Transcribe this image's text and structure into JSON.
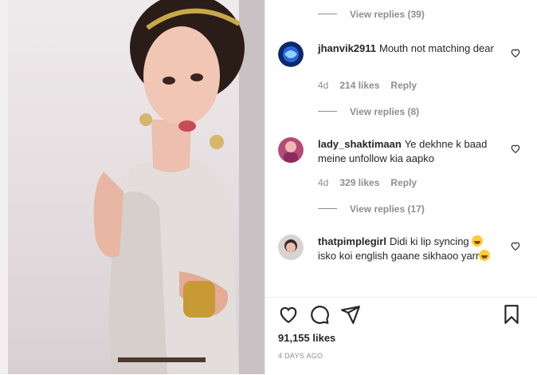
{
  "comments": [
    {
      "type": "view_replies",
      "text": "View replies (39)"
    },
    {
      "type": "comment",
      "username": "jhanvik2911",
      "text": "Mouth not matching dear",
      "time": "4d",
      "likes": "214 likes",
      "reply": "Reply"
    },
    {
      "type": "view_replies",
      "text": "View replies (8)"
    },
    {
      "type": "comment",
      "username": "lady_shaktimaan",
      "text": "Ye dekhne k baad meine unfollow kia aapko",
      "time": "4d",
      "likes": "329 likes",
      "reply": "Reply"
    },
    {
      "type": "view_replies",
      "text": "View replies (17)"
    },
    {
      "type": "comment",
      "username": "thatpimplegirl",
      "text_before": "Didi ki lip syncing",
      "text_middle": "isko koi english gaane sikhaoo yarr",
      "time": "",
      "likes": "",
      "reply": ""
    }
  ],
  "post": {
    "likes": "91,155 likes",
    "date": "4 DAYS AGO"
  },
  "icons": {
    "like": "heart-icon",
    "comment": "comment-bubble-icon",
    "share": "paper-plane-icon",
    "save": "bookmark-icon"
  },
  "colors": {
    "text": "#262626",
    "muted": "#8e8e8e",
    "border": "#efefef"
  }
}
